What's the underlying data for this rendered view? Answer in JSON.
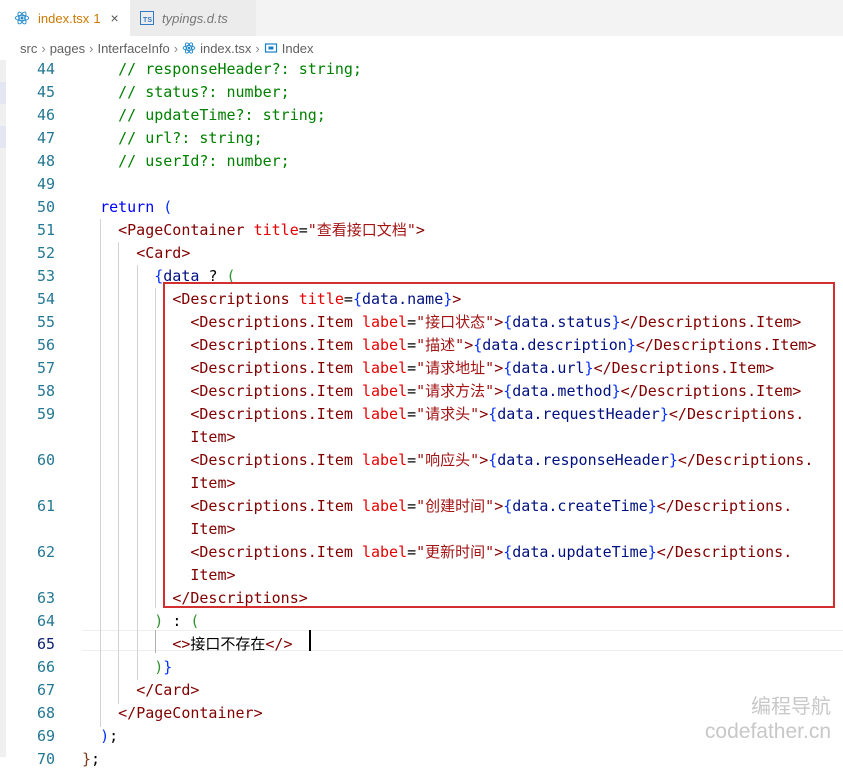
{
  "tabs": [
    {
      "name": "index.tsx",
      "badge": "1",
      "close": "×"
    },
    {
      "name": "typings.d.ts"
    }
  ],
  "breadcrumb": {
    "items": [
      "src",
      "pages",
      "InterfaceInfo",
      "index.tsx",
      "Index"
    ]
  },
  "code": {
    "l44": "// responseHeader?: string;",
    "l45": "// status?: number;",
    "l46": "// updateTime?: string;",
    "l47": "// url?: string;",
    "l48": "// userId?: number;",
    "ret": "return",
    "open_paren": "(",
    "page_container": "PageContainer",
    "title_attr": "title",
    "page_title": "\"查看接口文档\"",
    "card": "Card",
    "data_var": "data",
    "ternary_q": "?",
    "ternary_colon": ":",
    "descriptions": "Descriptions",
    "data_name": "data.name",
    "item_tag": "Descriptions.Item",
    "item_tag_wrap": "Descriptions.",
    "item_tag_rest": "Item",
    "label_attr": "label",
    "items": [
      {
        "label": "\"接口状态\"",
        "value": "data.status"
      },
      {
        "label": "\"描述\"",
        "value": "data.description"
      },
      {
        "label": "\"请求地址\"",
        "value": "data.url"
      },
      {
        "label": "\"请求方法\"",
        "value": "data.method"
      },
      {
        "label": "\"请求头\"",
        "value": "data.requestHeader"
      },
      {
        "label": "\"响应头\"",
        "value": "data.responseHeader"
      },
      {
        "label": "\"创建时间\"",
        "value": "data.createTime"
      },
      {
        "label": "\"更新时间\"",
        "value": "data.updateTime"
      }
    ],
    "not_exist": "接口不存在"
  },
  "line_numbers": [
    "44",
    "45",
    "46",
    "47",
    "48",
    "49",
    "50",
    "51",
    "52",
    "53",
    "54",
    "55",
    "56",
    "57",
    "58",
    "59",
    "60",
    "61",
    "62",
    "63",
    "64",
    "65",
    "66",
    "67",
    "68",
    "69",
    "70"
  ],
  "watermark": {
    "line1": "编程导航",
    "line2": "codefather.cn"
  },
  "colors": {
    "accent_box": "#d32f2f",
    "comment": "#008000",
    "keyword": "#0000ff",
    "tag": "#800000",
    "attr": "#e50000",
    "string": "#a31515"
  }
}
